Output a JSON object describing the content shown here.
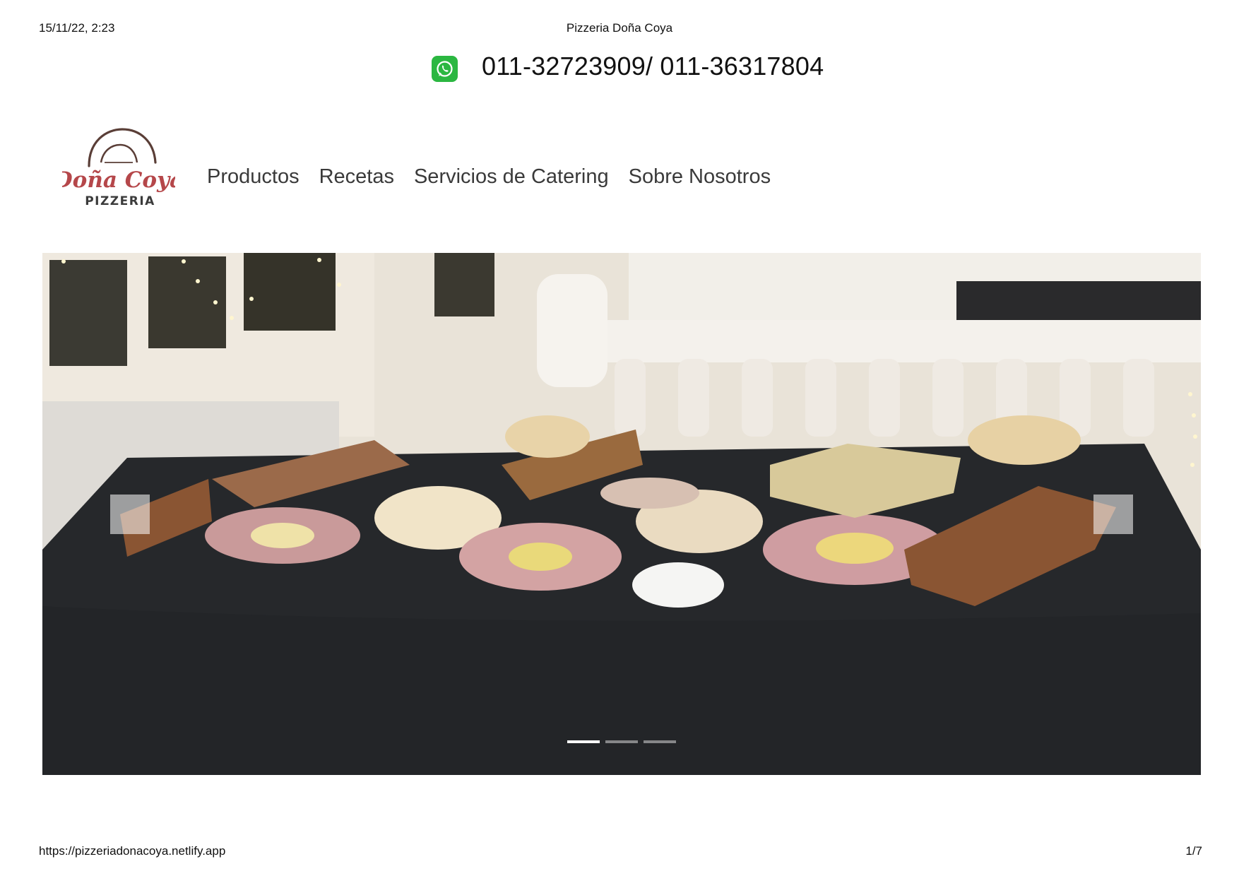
{
  "print_header": {
    "datetime": "15/11/22, 2:23",
    "title": "Pizzeria Doña Coya"
  },
  "contact": {
    "whatsapp_icon": "whatsapp-icon",
    "phones": "011-32723909/ 011-36317804"
  },
  "brand": {
    "name_script": "Doña Coya",
    "name_sub": "PIZZERIA"
  },
  "nav": {
    "items": [
      {
        "label": "Productos"
      },
      {
        "label": "Recetas"
      },
      {
        "label": "Servicios de Catering"
      },
      {
        "label": "Sobre Nosotros"
      }
    ]
  },
  "carousel": {
    "slide_count": 3,
    "active_index": 0,
    "image_subject": "catering-table-photo"
  },
  "print_footer": {
    "url": "https://pizzeriadonacoya.netlify.app",
    "page": "1/7"
  },
  "colors": {
    "whatsapp_green": "#2bb741",
    "brand_red": "#b5474a",
    "nav_text": "#3a3a3a"
  }
}
